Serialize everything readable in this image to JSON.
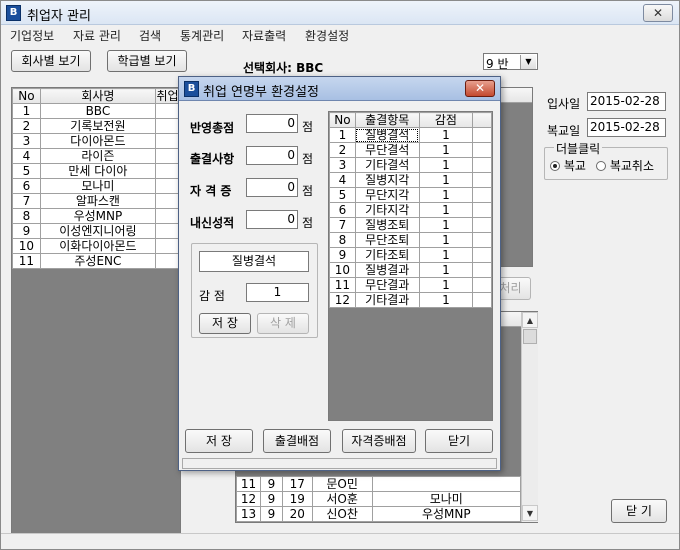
{
  "window": {
    "title": "취업자 관리",
    "close_label": "✕"
  },
  "menu": [
    "기업정보",
    "자료 관리",
    "검색",
    "통계관리",
    "자료출력",
    "환경설정"
  ],
  "toolbar": {
    "by_company": "회사별 보기",
    "by_class": "학급별 보기"
  },
  "selected_company": {
    "label": "선택회사: BBC"
  },
  "class_combo": {
    "value": "9 반"
  },
  "company_grid": {
    "headers": [
      "No",
      "회사명",
      "취업"
    ],
    "rows": [
      [
        "1",
        "BBC"
      ],
      [
        "2",
        "기록보전원"
      ],
      [
        "3",
        "다이아몬드"
      ],
      [
        "4",
        "라이즌"
      ],
      [
        "5",
        "만세 다이아"
      ],
      [
        "6",
        "모나미"
      ],
      [
        "7",
        "알파스캔"
      ],
      [
        "8",
        "우성MNP"
      ],
      [
        "9",
        "이성엔지니어링"
      ],
      [
        "10",
        "이화다이아몬드"
      ],
      [
        "11",
        "주성ENC"
      ]
    ]
  },
  "right_panel": {
    "join_date_label": "입사일",
    "join_date": "2015-02-28",
    "return_date_label": "복교일",
    "return_date": "2015-02-28",
    "doubleclick_group": "더블클릭",
    "radio_return": "복교",
    "radio_cancel": "복교취소",
    "process_partial": "처리",
    "close_button": "닫 기"
  },
  "student_grid": {
    "rows": [
      [
        "11",
        "9",
        "17",
        "문O민",
        ""
      ],
      [
        "12",
        "9",
        "19",
        "서O훈",
        "모나미"
      ],
      [
        "13",
        "9",
        "20",
        "신O찬",
        "우성MNP"
      ]
    ]
  },
  "dialog": {
    "title": "취업 연명부 환경설정",
    "close_label": "✕",
    "fields": [
      {
        "label": "반영총점",
        "value": "0",
        "unit": "점"
      },
      {
        "label": "출결사항",
        "value": "0",
        "unit": "점"
      },
      {
        "label": "자 격 증",
        "value": "0",
        "unit": "점"
      },
      {
        "label": "내신성적",
        "value": "0",
        "unit": "점"
      }
    ],
    "item_name": "질병결석",
    "deduct_label": "감  점",
    "deduct_value": "1",
    "save_small": "저 장",
    "delete_small": "삭 제",
    "grid_headers": [
      "No",
      "출결항목",
      "감점"
    ],
    "grid_rows": [
      [
        "1",
        "질병결석",
        "1"
      ],
      [
        "2",
        "무단결석",
        "1"
      ],
      [
        "3",
        "기타결석",
        "1"
      ],
      [
        "4",
        "질병지각",
        "1"
      ],
      [
        "5",
        "무단지각",
        "1"
      ],
      [
        "6",
        "기타지각",
        "1"
      ],
      [
        "7",
        "질병조퇴",
        "1"
      ],
      [
        "8",
        "무단조퇴",
        "1"
      ],
      [
        "9",
        "기타조퇴",
        "1"
      ],
      [
        "10",
        "질병결과",
        "1"
      ],
      [
        "11",
        "무단결과",
        "1"
      ],
      [
        "12",
        "기타결과",
        "1"
      ]
    ],
    "buttons": {
      "save": "저  장",
      "attendance": "출결배점",
      "cert": "자격증배점",
      "close": "닫기"
    }
  }
}
